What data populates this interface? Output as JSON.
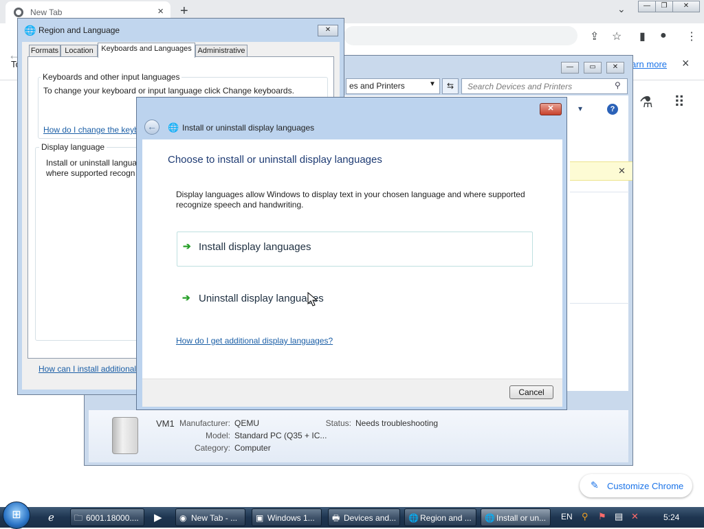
{
  "chrome": {
    "tab_title": "New Tab",
    "tab_close": "×",
    "new_tab": "+",
    "info_left": "To",
    "learn_more": "arn more",
    "info_close": "×",
    "customize_label": "Customize Chrome"
  },
  "devices_window": {
    "address": "es and Printers",
    "search_placeholder": "Search Devices and Printers",
    "details": {
      "name": "VM1",
      "manufacturer_label": "Manufacturer:",
      "manufacturer": "QEMU",
      "model_label": "Model:",
      "model": "Standard PC (Q35 + IC...",
      "category_label": "Category:",
      "category": "Computer",
      "status_label": "Status:",
      "status": "Needs troubleshooting"
    }
  },
  "region_window": {
    "title": "Region and Language",
    "tabs": [
      "Formats",
      "Location",
      "Keyboards and Languages",
      "Administrative"
    ],
    "keyboards_group": "Keyboards and other input languages",
    "keyboards_text": "To change your keyboard or input language click Change keyboards.",
    "keyboards_link": "How do I change the keyb",
    "display_group": "Display language",
    "display_text_1": "Install or uninstall langua",
    "display_text_2": "where supported recogn",
    "bottom_link": "How can I install additional"
  },
  "install_dialog": {
    "title": "Install or uninstall display languages",
    "heading": "Choose to install or uninstall display languages",
    "description": "Display languages allow Windows to display text in your chosen language and where supported recognize speech and handwriting.",
    "option_install": "Install display languages",
    "option_uninstall": "Uninstall display languages",
    "help_link": "How do I get additional display languages?",
    "cancel": "Cancel"
  },
  "taskbar": {
    "items": [
      "6001.18000....",
      "New Tab - ...",
      "Windows 1...",
      "Devices and...",
      "Region and ...",
      "Install or un..."
    ],
    "language": "EN",
    "clock": "5:24"
  }
}
